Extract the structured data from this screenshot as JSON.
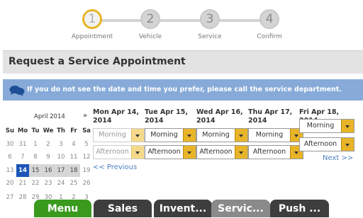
{
  "stepper": {
    "steps": [
      {
        "num": "1",
        "label": "Appointment"
      },
      {
        "num": "2",
        "label": "Vehicle"
      },
      {
        "num": "3",
        "label": "Service"
      },
      {
        "num": "4",
        "label": "Confirm"
      }
    ]
  },
  "title": "Request a Service Appointment",
  "info": {
    "icon": "chat-bubbles-icon",
    "text": "If you do not see the date and time you prefer, please call the service department."
  },
  "calendar": {
    "month_label": "April 2014",
    "next_label": "»",
    "dow": [
      "Su",
      "Mo",
      "Tu",
      "We",
      "Th",
      "Fr",
      "Sa"
    ],
    "weeks": [
      [
        "30",
        "31",
        "1",
        "2",
        "3",
        "4",
        "5"
      ],
      [
        "6",
        "7",
        "8",
        "9",
        "10",
        "11",
        "12"
      ],
      [
        "13",
        "14",
        "15",
        "16",
        "17",
        "18",
        "19"
      ],
      [
        "20",
        "21",
        "22",
        "23",
        "24",
        "25",
        "26"
      ],
      [
        "27",
        "28",
        "29",
        "30",
        "1",
        "2",
        "3"
      ]
    ]
  },
  "days": [
    {
      "head": "Mon Apr 14, 2014",
      "morning": "Morning",
      "afternoon": "Afternoon"
    },
    {
      "head": "Tue Apr 15, 2014",
      "morning": "Morning",
      "afternoon": "Afternoon"
    },
    {
      "head": "Wed Apr 16, 2014",
      "morning": "Morning",
      "afternoon": "Afternoon"
    },
    {
      "head": "Thu Apr 17, 2014",
      "morning": "Morning",
      "afternoon": "Afternoon"
    },
    {
      "head": "Fri Apr 18, 2014",
      "morning": "Morning",
      "afternoon": "Afternoon"
    }
  ],
  "prev_link": "<< Previous",
  "next_link": "Next >>",
  "nav": {
    "tabs": [
      {
        "label": "Menu",
        "color": "#3a9a1e"
      },
      {
        "label": "Sales",
        "color": "#3e3e3e"
      },
      {
        "label": "Invent...",
        "color": "#3e3e3e"
      },
      {
        "label": "Servic...",
        "color": "#8a8a8a"
      },
      {
        "label": "Push ...",
        "color": "#3e3e3e"
      }
    ]
  },
  "colors": {
    "accent": "#e8b428",
    "info_bar": "#87aad8",
    "selected_date": "#1c55b8"
  }
}
